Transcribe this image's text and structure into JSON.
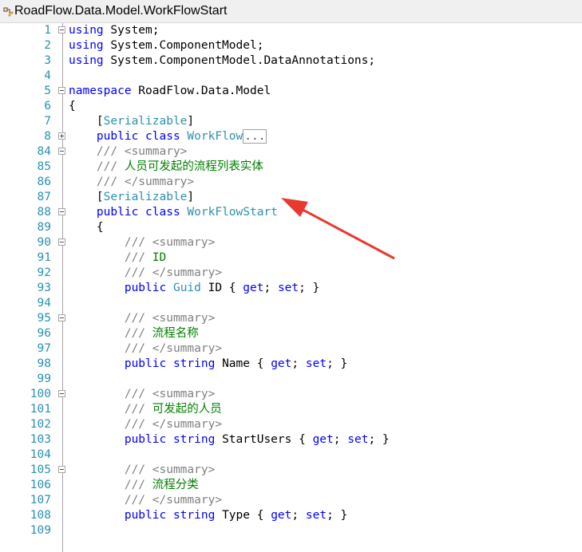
{
  "window": {
    "title": "RoadFlow.Data.Model.WorkFlowStart",
    "icon": "class-icon"
  },
  "code_lines": [
    {
      "n": "1",
      "fold": "minus",
      "tokens": [
        {
          "t": "kw",
          "v": "using"
        },
        {
          "t": "tx",
          "v": " System;"
        }
      ]
    },
    {
      "n": "2",
      "fold": "",
      "tokens": [
        {
          "t": "kw",
          "v": "using"
        },
        {
          "t": "tx",
          "v": " System.ComponentModel;"
        }
      ]
    },
    {
      "n": "3",
      "fold": "",
      "tokens": [
        {
          "t": "kw",
          "v": "using"
        },
        {
          "t": "tx",
          "v": " System.ComponentModel.DataAnnotations;"
        }
      ]
    },
    {
      "n": "4",
      "fold": "",
      "tokens": []
    },
    {
      "n": "5",
      "fold": "minus",
      "tokens": [
        {
          "t": "kw",
          "v": "namespace"
        },
        {
          "t": "tx",
          "v": " RoadFlow.Data.Model"
        }
      ]
    },
    {
      "n": "6",
      "fold": "",
      "tokens": [
        {
          "t": "tx",
          "v": "{"
        }
      ]
    },
    {
      "n": "7",
      "fold": "",
      "tokens": [
        {
          "t": "tx",
          "v": "    ["
        },
        {
          "t": "ty",
          "v": "Serializable"
        },
        {
          "t": "tx",
          "v": "]"
        }
      ]
    },
    {
      "n": "8",
      "fold": "plus",
      "tokens": [
        {
          "t": "tx",
          "v": "    "
        },
        {
          "t": "kw",
          "v": "public class"
        },
        {
          "t": "tx",
          "v": " "
        },
        {
          "t": "ty",
          "v": "WorkFlow"
        },
        {
          "t": "collapsed",
          "v": "..."
        }
      ]
    },
    {
      "n": "84",
      "fold": "minus",
      "tokens": [
        {
          "t": "tx",
          "v": "    "
        },
        {
          "t": "gray",
          "v": "/// <summary>"
        }
      ]
    },
    {
      "n": "85",
      "fold": "",
      "tokens": [
        {
          "t": "tx",
          "v": "    "
        },
        {
          "t": "gray",
          "v": "/// "
        },
        {
          "t": "cm",
          "v": "人员可发起的流程列表实体"
        }
      ]
    },
    {
      "n": "86",
      "fold": "",
      "tokens": [
        {
          "t": "tx",
          "v": "    "
        },
        {
          "t": "gray",
          "v": "/// </summary>"
        }
      ]
    },
    {
      "n": "87",
      "fold": "",
      "tokens": [
        {
          "t": "tx",
          "v": "    ["
        },
        {
          "t": "ty",
          "v": "Serializable"
        },
        {
          "t": "tx",
          "v": "]"
        }
      ]
    },
    {
      "n": "88",
      "fold": "minus",
      "tokens": [
        {
          "t": "tx",
          "v": "    "
        },
        {
          "t": "kw",
          "v": "public class"
        },
        {
          "t": "tx",
          "v": " "
        },
        {
          "t": "ty",
          "v": "WorkFlowStart"
        }
      ]
    },
    {
      "n": "89",
      "fold": "",
      "tokens": [
        {
          "t": "tx",
          "v": "    {"
        }
      ]
    },
    {
      "n": "90",
      "fold": "minus",
      "tokens": [
        {
          "t": "tx",
          "v": "        "
        },
        {
          "t": "gray",
          "v": "/// <summary>"
        }
      ]
    },
    {
      "n": "91",
      "fold": "",
      "tokens": [
        {
          "t": "tx",
          "v": "        "
        },
        {
          "t": "gray",
          "v": "/// "
        },
        {
          "t": "cm",
          "v": "ID"
        }
      ]
    },
    {
      "n": "92",
      "fold": "",
      "tokens": [
        {
          "t": "tx",
          "v": "        "
        },
        {
          "t": "gray",
          "v": "/// </summary>"
        }
      ]
    },
    {
      "n": "93",
      "fold": "",
      "tokens": [
        {
          "t": "tx",
          "v": "        "
        },
        {
          "t": "kw",
          "v": "public"
        },
        {
          "t": "tx",
          "v": " "
        },
        {
          "t": "ty",
          "v": "Guid"
        },
        {
          "t": "tx",
          "v": " ID { "
        },
        {
          "t": "kw",
          "v": "get"
        },
        {
          "t": "tx",
          "v": "; "
        },
        {
          "t": "kw",
          "v": "set"
        },
        {
          "t": "tx",
          "v": "; }"
        }
      ]
    },
    {
      "n": "94",
      "fold": "",
      "tokens": []
    },
    {
      "n": "95",
      "fold": "minus",
      "tokens": [
        {
          "t": "tx",
          "v": "        "
        },
        {
          "t": "gray",
          "v": "/// <summary>"
        }
      ]
    },
    {
      "n": "96",
      "fold": "",
      "tokens": [
        {
          "t": "tx",
          "v": "        "
        },
        {
          "t": "gray",
          "v": "/// "
        },
        {
          "t": "cm",
          "v": "流程名称"
        }
      ]
    },
    {
      "n": "97",
      "fold": "",
      "tokens": [
        {
          "t": "tx",
          "v": "        "
        },
        {
          "t": "gray",
          "v": "/// </summary>"
        }
      ]
    },
    {
      "n": "98",
      "fold": "",
      "tokens": [
        {
          "t": "tx",
          "v": "        "
        },
        {
          "t": "kw",
          "v": "public string"
        },
        {
          "t": "tx",
          "v": " Name { "
        },
        {
          "t": "kw",
          "v": "get"
        },
        {
          "t": "tx",
          "v": "; "
        },
        {
          "t": "kw",
          "v": "set"
        },
        {
          "t": "tx",
          "v": "; }"
        }
      ]
    },
    {
      "n": "99",
      "fold": "",
      "tokens": []
    },
    {
      "n": "100",
      "fold": "minus",
      "tokens": [
        {
          "t": "tx",
          "v": "        "
        },
        {
          "t": "gray",
          "v": "/// <summary>"
        }
      ]
    },
    {
      "n": "101",
      "fold": "",
      "tokens": [
        {
          "t": "tx",
          "v": "        "
        },
        {
          "t": "gray",
          "v": "/// "
        },
        {
          "t": "cm",
          "v": "可发起的人员"
        }
      ]
    },
    {
      "n": "102",
      "fold": "",
      "tokens": [
        {
          "t": "tx",
          "v": "        "
        },
        {
          "t": "gray",
          "v": "/// </summary>"
        }
      ]
    },
    {
      "n": "103",
      "fold": "",
      "tokens": [
        {
          "t": "tx",
          "v": "        "
        },
        {
          "t": "kw",
          "v": "public string"
        },
        {
          "t": "tx",
          "v": " StartUsers { "
        },
        {
          "t": "kw",
          "v": "get"
        },
        {
          "t": "tx",
          "v": "; "
        },
        {
          "t": "kw",
          "v": "set"
        },
        {
          "t": "tx",
          "v": "; }"
        }
      ]
    },
    {
      "n": "104",
      "fold": "",
      "tokens": []
    },
    {
      "n": "105",
      "fold": "minus",
      "tokens": [
        {
          "t": "tx",
          "v": "        "
        },
        {
          "t": "gray",
          "v": "/// <summary>"
        }
      ]
    },
    {
      "n": "106",
      "fold": "",
      "tokens": [
        {
          "t": "tx",
          "v": "        "
        },
        {
          "t": "gray",
          "v": "/// "
        },
        {
          "t": "cm",
          "v": "流程分类"
        }
      ]
    },
    {
      "n": "107",
      "fold": "",
      "tokens": [
        {
          "t": "tx",
          "v": "        "
        },
        {
          "t": "gray",
          "v": "/// </summary>"
        }
      ]
    },
    {
      "n": "108",
      "fold": "",
      "tokens": [
        {
          "t": "tx",
          "v": "        "
        },
        {
          "t": "kw",
          "v": "public string"
        },
        {
          "t": "tx",
          "v": " Type { "
        },
        {
          "t": "kw",
          "v": "get"
        },
        {
          "t": "tx",
          "v": "; "
        },
        {
          "t": "kw",
          "v": "set"
        },
        {
          "t": "tx",
          "v": "; }"
        }
      ]
    },
    {
      "n": "109",
      "fold": "",
      "tokens": []
    }
  ],
  "annotation": {
    "icon": "red-arrow-icon",
    "color": "#e8392f"
  },
  "colors": {
    "keyword": "#0000ff",
    "type": "#2b91af",
    "comment": "#008000",
    "doc_tag": "#808080",
    "line_number": "#2b91af"
  }
}
